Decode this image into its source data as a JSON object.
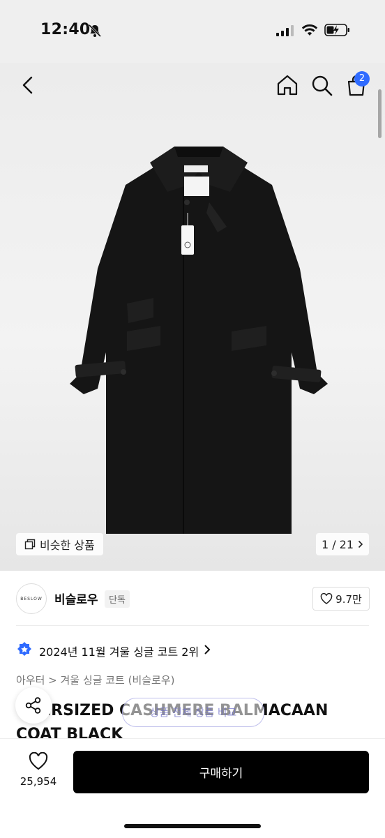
{
  "status_bar": {
    "time": "12:40"
  },
  "header": {
    "cart_count": "2"
  },
  "gallery": {
    "similar_label": "비슷한 상품",
    "pager": "1 / 21"
  },
  "brand": {
    "logo_text": "BESLOW",
    "name": "비슬로우",
    "tag": "단독",
    "likes": "9.7만"
  },
  "ranking": {
    "text": "2024년 11월 겨울 싱글 코트 2위"
  },
  "breadcrumb": "아우터 > 겨울 싱글 코트 (비슬로우)",
  "product": {
    "title": "OVERSIZED CASHMERE BALMACAAN COAT BLACK",
    "overlay_text": "상품 전체 상품 비교"
  },
  "bottom_bar": {
    "like_count": "25,954",
    "buy_label": "구매하기"
  },
  "colors": {
    "accent": "#2f6bff",
    "buy_bg": "#000000"
  }
}
